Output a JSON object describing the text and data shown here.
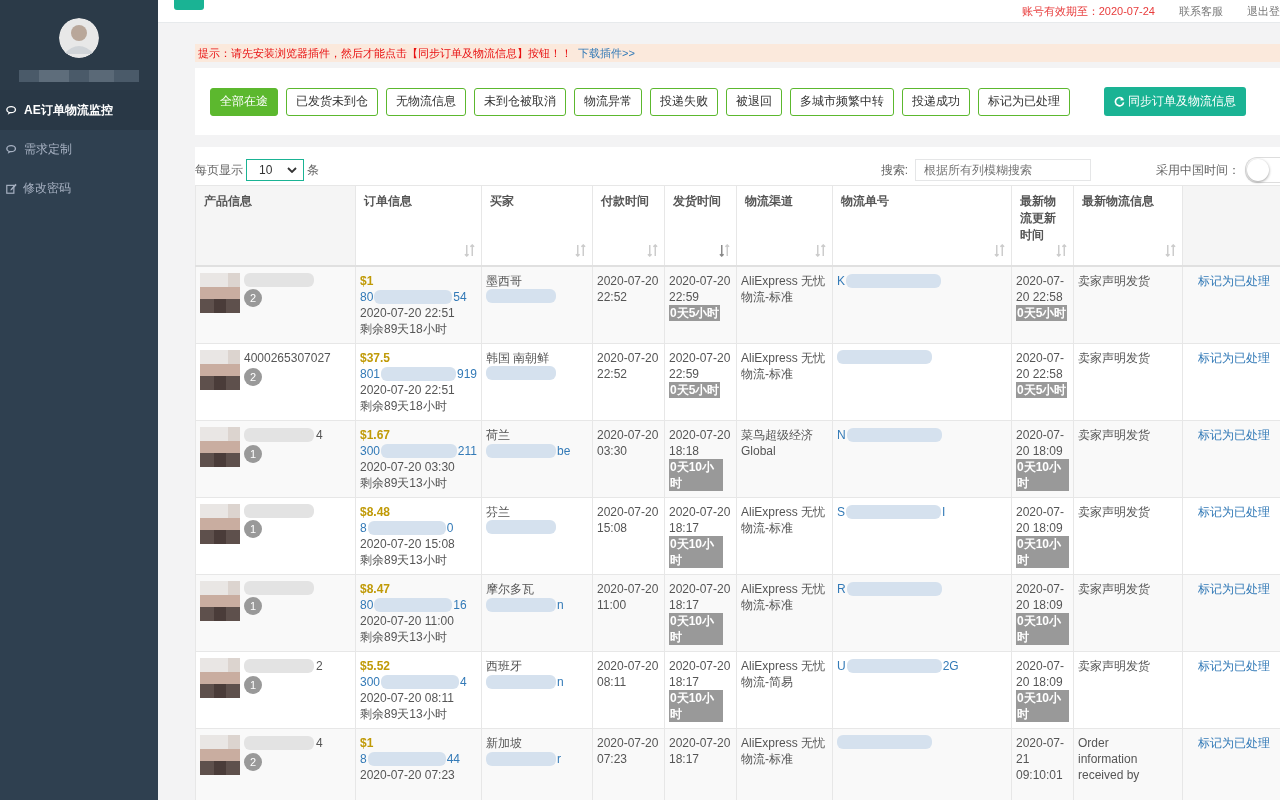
{
  "header": {
    "expiry": "账号有效期至：2020-07-24",
    "support": "联系客服",
    "logout": "退出登"
  },
  "sidebar": {
    "items": [
      {
        "label": "AE订单物流监控",
        "selected": true
      },
      {
        "label": "需求定制",
        "selected": false
      },
      {
        "label": "修改密码",
        "selected": false
      }
    ]
  },
  "notice": {
    "text": "提示：请先安装浏览器插件，然后才能点击【同步订单及物流信息】按钮！！",
    "link": "下载插件>>"
  },
  "filters": [
    {
      "label": "全部在途",
      "selected": true
    },
    {
      "label": "已发货未到仓",
      "selected": false
    },
    {
      "label": "无物流信息",
      "selected": false
    },
    {
      "label": "未到仓被取消",
      "selected": false
    },
    {
      "label": "物流异常",
      "selected": false
    },
    {
      "label": "投递失败",
      "selected": false
    },
    {
      "label": "被退回",
      "selected": false
    },
    {
      "label": "多城市频繁中转",
      "selected": false
    },
    {
      "label": "投递成功",
      "selected": false
    },
    {
      "label": "标记为已处理",
      "selected": false
    }
  ],
  "sync_button": "同步订单及物流信息",
  "page_size": {
    "label_before": "每页显示",
    "value": "10",
    "label_after": "条"
  },
  "search": {
    "label": "搜索:",
    "placeholder": "根据所有列模糊搜索"
  },
  "china_time": {
    "label": "采用中国时间：",
    "on": false
  },
  "table": {
    "columns": [
      {
        "label": "产品信息"
      },
      {
        "label": "订单信息",
        "sorted": false
      },
      {
        "label": "买家",
        "sorted": false
      },
      {
        "label": "付款时间",
        "sorted": false
      },
      {
        "label": "发货时间",
        "sorted": true
      },
      {
        "label": "物流渠道",
        "sorted": false
      },
      {
        "label": "物流单号",
        "sorted": false
      },
      {
        "label": "最新物流更新时间",
        "sorted": false
      },
      {
        "label": "最新物流信息",
        "sorted": false
      }
    ],
    "rows": [
      {
        "qty": "2",
        "price": "$1",
        "order_start": "80",
        "order_end": "54",
        "order_time": "2020-07-20 22:51",
        "remaining": "剩余89天18小时",
        "buyer": "墨西哥",
        "paid": "2020-07-20 22:52",
        "shipped": "2020-07-20 22:59",
        "shipped_age": "0天5小时",
        "channel": "AliExpress 无忧物流-标准",
        "track_start": "K",
        "updated": "2020-07-20 22:58",
        "updated_age": "0天5小时",
        "info": "卖家声明发货",
        "action": "标记为已处理"
      },
      {
        "product_id": "4000265307027",
        "qty": "2",
        "price": "$37.5",
        "order_start": "801",
        "order_end": "919",
        "order_time": "2020-07-20 22:51",
        "remaining": "剩余89天18小时",
        "buyer": "韩国 南朝鲜",
        "paid": "2020-07-20 22:52",
        "shipped": "2020-07-20 22:59",
        "shipped_age": "0天5小时",
        "channel": "AliExpress 无忧物流-标准",
        "updated": "2020-07-20 22:58",
        "updated_age": "0天5小时",
        "info": "卖家声明发货",
        "action": "标记为已处理"
      },
      {
        "product_end": "4",
        "qty": "1",
        "price": "$1.67",
        "order_start": "300",
        "order_end": "211",
        "order_time": "2020-07-20 03:30",
        "remaining": "剩余89天13小时",
        "buyer": "荷兰",
        "buyer_end": "be",
        "paid": "2020-07-20 03:30",
        "shipped": "2020-07-20 18:18",
        "shipped_age": "0天10小时",
        "channel": "菜鸟超级经济Global",
        "track_start": "N",
        "updated": "2020-07-20 18:09",
        "updated_age": "0天10小时",
        "info": "卖家声明发货",
        "action": "标记为已处理"
      },
      {
        "qty": "1",
        "price": "$8.48",
        "order_start": "8",
        "order_end": "0",
        "order_time": "2020-07-20 15:08",
        "remaining": "剩余89天13小时",
        "buyer": "芬兰",
        "paid": "2020-07-20 15:08",
        "shipped": "2020-07-20 18:17",
        "shipped_age": "0天10小时",
        "channel": "AliExpress 无忧物流-标准",
        "track_start": "S",
        "track_end": "I",
        "updated": "2020-07-20 18:09",
        "updated_age": "0天10小时",
        "info": "卖家声明发货",
        "action": "标记为已处理"
      },
      {
        "qty": "1",
        "price": "$8.47",
        "order_start": "80",
        "order_end": "16",
        "order_time": "2020-07-20 11:00",
        "remaining": "剩余89天13小时",
        "buyer": "摩尔多瓦",
        "buyer_end": "n",
        "paid": "2020-07-20 11:00",
        "shipped": "2020-07-20 18:17",
        "shipped_age": "0天10小时",
        "channel": "AliExpress 无忧物流-标准",
        "track_start": "R",
        "updated": "2020-07-20 18:09",
        "updated_age": "0天10小时",
        "info": "卖家声明发货",
        "action": "标记为已处理"
      },
      {
        "product_end": "2",
        "qty": "1",
        "price": "$5.52",
        "order_start": "300",
        "order_end": "4",
        "order_time": "2020-07-20 08:11",
        "remaining": "剩余89天13小时",
        "buyer": "西班牙",
        "buyer_end": "n",
        "paid": "2020-07-20 08:11",
        "shipped": "2020-07-20 18:17",
        "shipped_age": "0天10小时",
        "channel": "AliExpress 无忧物流-简易",
        "track_start": "U",
        "track_end": "2G",
        "updated": "2020-07-20 18:09",
        "updated_age": "0天10小时",
        "info": "卖家声明发货",
        "action": "标记为已处理"
      },
      {
        "product_end": "4",
        "qty": "2",
        "price": "$1",
        "order_start": "8",
        "order_end": "44",
        "order_time": "2020-07-20 07:23",
        "buyer": "新加坡",
        "buyer_end": "r",
        "paid": "2020-07-20 07:23",
        "shipped": "2020-07-20 18:17",
        "channel": "AliExpress 无忧物流-标准",
        "updated": "2020-07-21 09:10:01",
        "info": "Order information received by",
        "action": "标记为已处理"
      }
    ]
  }
}
